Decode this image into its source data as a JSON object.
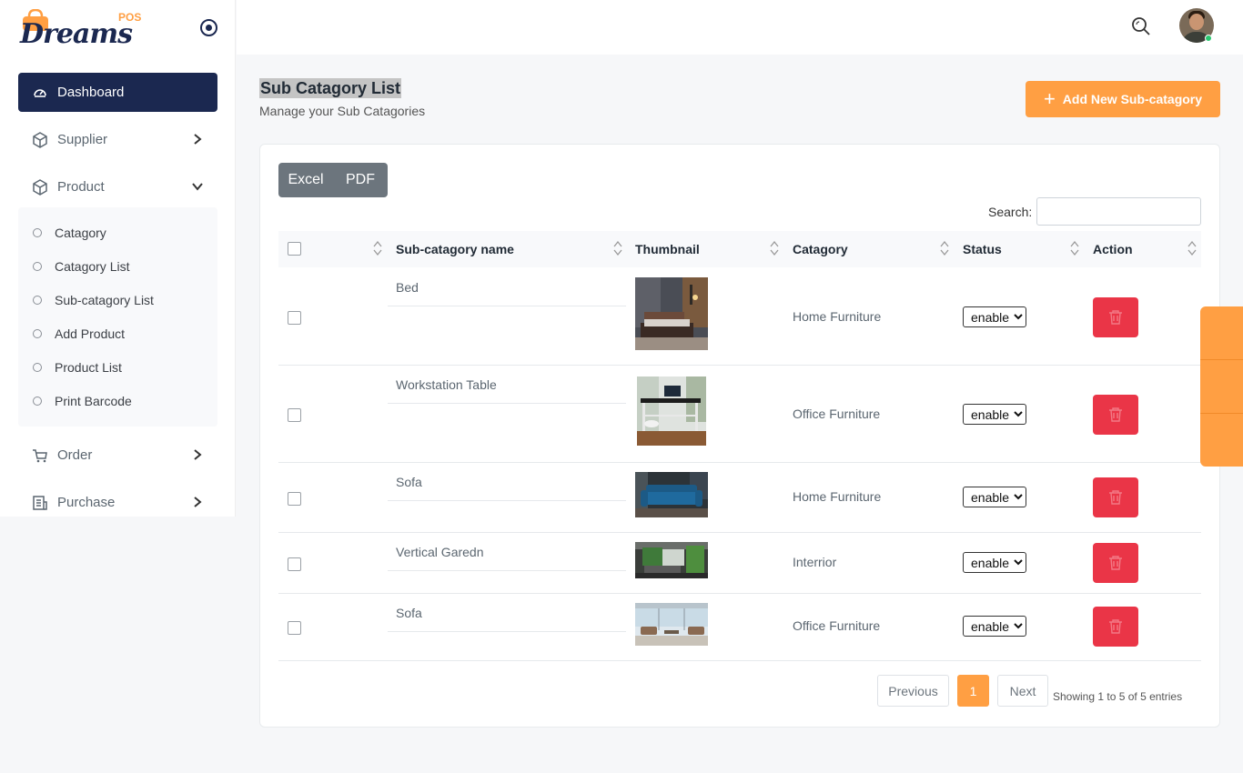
{
  "brand": {
    "name": "Dreams",
    "tag": "POS"
  },
  "sidebar": {
    "items": [
      {
        "label": "Dashboard",
        "icon": "dashboard-icon"
      },
      {
        "label": "Supplier",
        "icon": "box-icon"
      },
      {
        "label": "Product",
        "icon": "box-icon"
      },
      {
        "label": "Order",
        "icon": "cart-icon"
      },
      {
        "label": "Purchase",
        "icon": "receipt-icon"
      }
    ],
    "submenu": [
      {
        "label": "Catagory"
      },
      {
        "label": "Catagory List"
      },
      {
        "label": "Sub-catagory List"
      },
      {
        "label": "Add Product"
      },
      {
        "label": "Product List"
      },
      {
        "label": "Print Barcode"
      }
    ]
  },
  "page": {
    "title": "Sub Catagory List",
    "subtitle": "Manage your Sub Catagories",
    "add_button": "Add New Sub-catagory"
  },
  "export": {
    "excel": "Excel",
    "pdf": "PDF"
  },
  "search": {
    "label": "Search:",
    "value": ""
  },
  "table": {
    "columns": [
      "Sub-catagory name",
      "Thumbnail",
      "Catagory",
      "Status",
      "Action"
    ],
    "rows": [
      {
        "name": "Bed",
        "category": "Home Furniture",
        "status": "enable",
        "thumb": "bed-thumbnail"
      },
      {
        "name": "Workstation Table",
        "category": "Office Furniture",
        "status": "enable",
        "thumb": "workstation-thumbnail"
      },
      {
        "name": "Sofa",
        "category": "Home Furniture",
        "status": "enable",
        "thumb": "sofa-thumbnail"
      },
      {
        "name": "Vertical Garedn",
        "category": "Interrior",
        "status": "enable",
        "thumb": "garden-thumbnail"
      },
      {
        "name": "Sofa",
        "category": "Office Furniture",
        "status": "enable",
        "thumb": "office-sofa-thumbnail"
      }
    ],
    "status_options": [
      "enable"
    ]
  },
  "pagination": {
    "previous": "Previous",
    "current": "1",
    "next": "Next",
    "info": "Showing 1 to 5 of 5 entries"
  },
  "colors": {
    "primary": "#1b2850",
    "accent": "#ff9f43",
    "danger": "#ea3547",
    "secondary": "#6c757d"
  }
}
